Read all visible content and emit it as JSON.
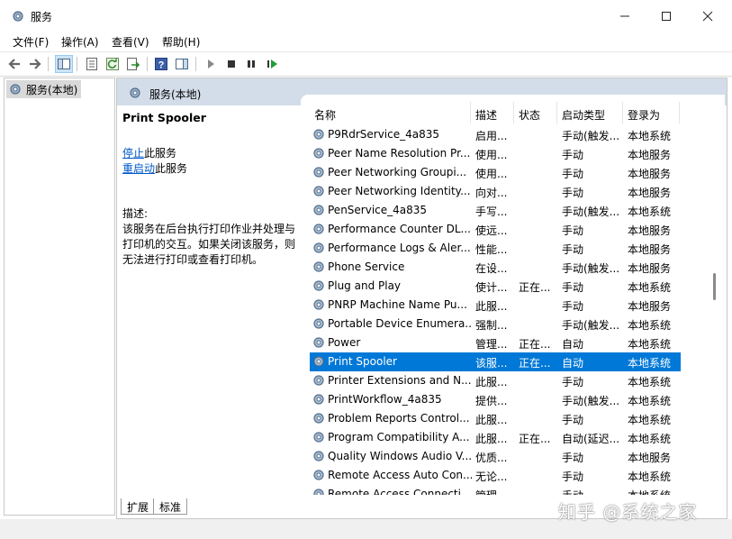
{
  "window": {
    "title": "服务"
  },
  "menu": [
    "文件(F)",
    "操作(A)",
    "查看(V)",
    "帮助(H)"
  ],
  "tree": {
    "root_label": "服务(本地)"
  },
  "panel": {
    "header": "服务(本地)",
    "selected_service": "Print Spooler",
    "stop_link": "停止",
    "stop_suffix": "此服务",
    "restart_link": "重启动",
    "restart_suffix": "此服务",
    "description_label": "描述:",
    "description_text": "该服务在后台执行打印作业并处理与打印机的交互。如果关闭该服务，则无法进行打印或查看打印机。"
  },
  "columns": {
    "name": "名称",
    "desc": "描述",
    "status": "状态",
    "startup": "启动类型",
    "logon": "登录为"
  },
  "rows": [
    {
      "name": "P9RdrService_4a835",
      "desc": "启用...",
      "status": "",
      "startup": "手动(触发...",
      "logon": "本地系统"
    },
    {
      "name": "Peer Name Resolution Pr...",
      "desc": "使用...",
      "status": "",
      "startup": "手动",
      "logon": "本地服务"
    },
    {
      "name": "Peer Networking Groupi...",
      "desc": "使用...",
      "status": "",
      "startup": "手动",
      "logon": "本地服务"
    },
    {
      "name": "Peer Networking Identity...",
      "desc": "向对...",
      "status": "",
      "startup": "手动",
      "logon": "本地服务"
    },
    {
      "name": "PenService_4a835",
      "desc": "手写...",
      "status": "",
      "startup": "手动(触发...",
      "logon": "本地系统"
    },
    {
      "name": "Performance Counter DL...",
      "desc": "使远...",
      "status": "",
      "startup": "手动",
      "logon": "本地服务"
    },
    {
      "name": "Performance Logs & Aler...",
      "desc": "性能...",
      "status": "",
      "startup": "手动",
      "logon": "本地服务"
    },
    {
      "name": "Phone Service",
      "desc": "在设...",
      "status": "",
      "startup": "手动(触发...",
      "logon": "本地服务"
    },
    {
      "name": "Plug and Play",
      "desc": "使计...",
      "status": "正在...",
      "startup": "手动",
      "logon": "本地系统"
    },
    {
      "name": "PNRP Machine Name Pu...",
      "desc": "此服...",
      "status": "",
      "startup": "手动",
      "logon": "本地服务"
    },
    {
      "name": "Portable Device Enumera...",
      "desc": "强制...",
      "status": "",
      "startup": "手动(触发...",
      "logon": "本地系统"
    },
    {
      "name": "Power",
      "desc": "管理...",
      "status": "正在...",
      "startup": "自动",
      "logon": "本地系统"
    },
    {
      "name": "Print Spooler",
      "desc": "该服...",
      "status": "正在...",
      "startup": "自动",
      "logon": "本地系统",
      "selected": true
    },
    {
      "name": "Printer Extensions and N...",
      "desc": "此服...",
      "status": "",
      "startup": "手动",
      "logon": "本地系统"
    },
    {
      "name": "PrintWorkflow_4a835",
      "desc": "提供...",
      "status": "",
      "startup": "手动(触发...",
      "logon": "本地系统"
    },
    {
      "name": "Problem Reports Control...",
      "desc": "此服...",
      "status": "",
      "startup": "手动",
      "logon": "本地系统"
    },
    {
      "name": "Program Compatibility A...",
      "desc": "此服...",
      "status": "正在...",
      "startup": "自动(延迟...",
      "logon": "本地系统"
    },
    {
      "name": "Quality Windows Audio V...",
      "desc": "优质...",
      "status": "",
      "startup": "手动",
      "logon": "本地服务"
    },
    {
      "name": "Remote Access Auto Con...",
      "desc": "无论...",
      "status": "",
      "startup": "手动",
      "logon": "本地系统"
    },
    {
      "name": "Remote Access Connecti...",
      "desc": "管理...",
      "status": "",
      "startup": "手动",
      "logon": "本地系统"
    }
  ],
  "tabs": [
    "扩展",
    "标准"
  ],
  "watermark": "知乎 @系统之家",
  "colors": {
    "selection": "#0078d7",
    "header_bg": "#d3dde9",
    "link": "#0058c8"
  }
}
